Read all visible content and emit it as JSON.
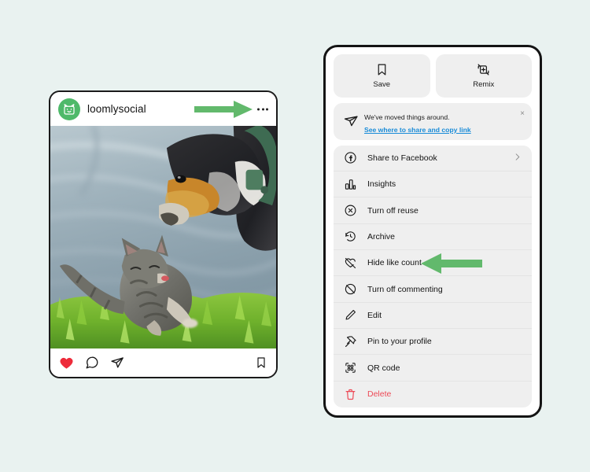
{
  "theme": {
    "page_background": "#e9f2f0",
    "arrow_green": "#62b96c",
    "accent_blue": "#1a8cd8",
    "danger_red": "#ed4956",
    "avatar_green": "#4fb96a",
    "menu_grey": "#efefef"
  },
  "post": {
    "username": "loomlysocial",
    "avatar_icon": "cat-logo-icon",
    "more_options_icon": "ellipsis-icon",
    "photo_alt": "Dog nuzzling a kitten on grass",
    "actions": {
      "like_icon": "heart-filled-icon",
      "comment_icon": "comment-bubble-icon",
      "share_icon": "paper-plane-icon",
      "save_icon": "bookmark-icon"
    }
  },
  "annotations": {
    "header_arrow": "arrow-right-to-more-options",
    "menu_arrow": "arrow-left-to-hide-like-count"
  },
  "menu": {
    "quick_actions": [
      {
        "label": "Save",
        "icon": "bookmark-icon"
      },
      {
        "label": "Remix",
        "icon": "remix-loop-icon"
      }
    ],
    "notice": {
      "icon": "paper-plane-icon",
      "title": "We've moved things around.",
      "link": "See where to share and copy link",
      "close_label": "×"
    },
    "items": [
      {
        "label": "Share to Facebook",
        "icon": "facebook-icon",
        "chevron": "›",
        "danger": false
      },
      {
        "label": "Insights",
        "icon": "bar-chart-icon",
        "chevron": "",
        "danger": false
      },
      {
        "label": "Turn off reuse",
        "icon": "circle-x-icon",
        "chevron": "",
        "danger": false
      },
      {
        "label": "Archive",
        "icon": "clock-rewind-icon",
        "chevron": "",
        "danger": false
      },
      {
        "label": "Hide like count",
        "icon": "heart-slash-icon",
        "chevron": "",
        "danger": false
      },
      {
        "label": "Turn off commenting",
        "icon": "comment-slash-icon",
        "chevron": "",
        "danger": false
      },
      {
        "label": "Edit",
        "icon": "pencil-icon",
        "chevron": "",
        "danger": false
      },
      {
        "label": "Pin to your profile",
        "icon": "pin-icon",
        "chevron": "",
        "danger": false
      },
      {
        "label": "QR code",
        "icon": "qr-code-icon",
        "chevron": "",
        "danger": false
      },
      {
        "label": "Delete",
        "icon": "trash-icon",
        "chevron": "",
        "danger": true
      }
    ]
  }
}
